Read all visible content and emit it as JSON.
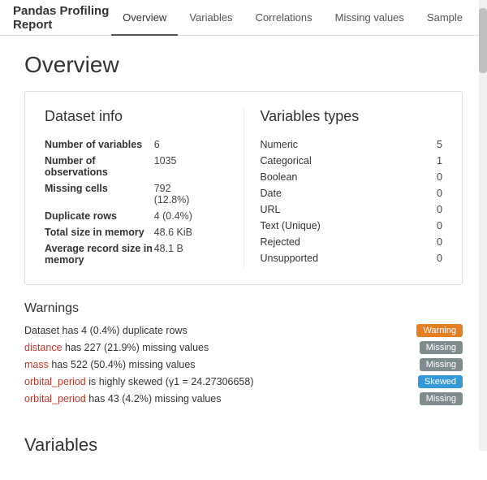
{
  "header": {
    "title": "Pandas Profiling Report",
    "nav": [
      {
        "label": "Overview",
        "active": true
      },
      {
        "label": "Variables",
        "active": false
      },
      {
        "label": "Correlations",
        "active": false
      },
      {
        "label": "Missing values",
        "active": false
      },
      {
        "label": "Sample",
        "active": false
      }
    ]
  },
  "page": {
    "title": "Overview"
  },
  "dataset_info": {
    "section_title": "Dataset info",
    "rows": [
      {
        "label": "Number of variables",
        "value": "6"
      },
      {
        "label": "Number of observations",
        "value": "1035"
      },
      {
        "label": "Missing cells",
        "value": "792\n(12.8%)"
      },
      {
        "label": "Duplicate rows",
        "value": "4 (0.4%)"
      },
      {
        "label": "Total size in memory",
        "value": "48.6 KiB"
      },
      {
        "label": "Average record size in memory",
        "value": "48.1 B"
      }
    ]
  },
  "variables_types": {
    "section_title": "Variables types",
    "rows": [
      {
        "label": "Numeric",
        "value": "5"
      },
      {
        "label": "Categorical",
        "value": "1"
      },
      {
        "label": "Boolean",
        "value": "0"
      },
      {
        "label": "Date",
        "value": "0"
      },
      {
        "label": "URL",
        "value": "0"
      },
      {
        "label": "Text (Unique)",
        "value": "0"
      },
      {
        "label": "Rejected",
        "value": "0"
      },
      {
        "label": "Unsupported",
        "value": "0"
      }
    ]
  },
  "warnings": {
    "title": "Warnings",
    "items": [
      {
        "text_parts": [
          {
            "text": "Dataset has 4 (0.4%) duplicate rows",
            "type": "normal"
          }
        ],
        "badge": {
          "label": "Warning",
          "type": "warning"
        }
      },
      {
        "text_parts": [
          {
            "text": "distance",
            "type": "varname"
          },
          {
            "text": " has 227 (21.9%) missing values",
            "type": "normal"
          }
        ],
        "badge": {
          "label": "Missing",
          "type": "missing"
        }
      },
      {
        "text_parts": [
          {
            "text": "mass",
            "type": "varname"
          },
          {
            "text": " has 522 (50.4%) missing values",
            "type": "normal"
          }
        ],
        "badge": {
          "label": "Missing",
          "type": "missing"
        }
      },
      {
        "text_parts": [
          {
            "text": "orbital_period",
            "type": "varname"
          },
          {
            "text": " is highly skewed (γ1 = 24.27306658)",
            "type": "normal"
          }
        ],
        "badge": {
          "label": "Skewed",
          "type": "skewed"
        }
      },
      {
        "text_parts": [
          {
            "text": "orbital_period",
            "type": "varname"
          },
          {
            "text": " has 43 (4.2%) missing values",
            "type": "normal"
          }
        ],
        "badge": {
          "label": "Missing",
          "type": "missing"
        }
      }
    ]
  },
  "variables_section": {
    "title": "Variables"
  }
}
